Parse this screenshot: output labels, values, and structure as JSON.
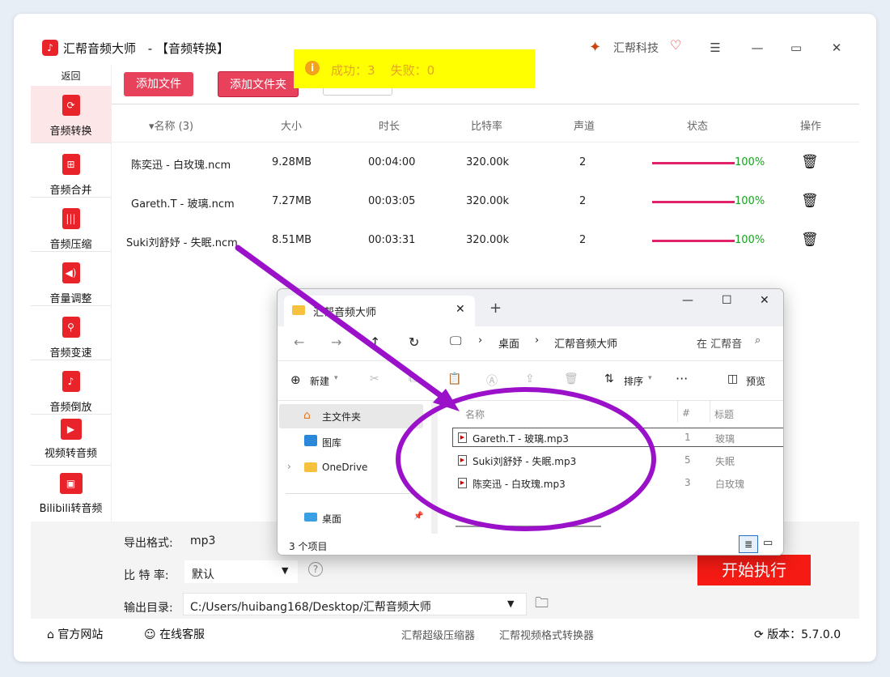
{
  "app": {
    "title": "汇帮音频大师",
    "page_title": "- 【音频转换】",
    "brand": "汇帮科技"
  },
  "sidebar": {
    "back_label": "返回",
    "items": [
      {
        "label": "音频转换",
        "icon": "audio-convert-icon",
        "active": true
      },
      {
        "label": "音频合并",
        "icon": "audio-merge-icon"
      },
      {
        "label": "音频压缩",
        "icon": "audio-compress-icon"
      },
      {
        "label": "音量调整",
        "icon": "volume-icon"
      },
      {
        "label": "音频变速",
        "icon": "mic-icon"
      },
      {
        "label": "音频倒放",
        "icon": "music-note-icon"
      },
      {
        "label": "视频转音频",
        "icon": "video-to-audio-icon"
      },
      {
        "label": "Bilibili转音频",
        "icon": "bilibili-icon"
      }
    ]
  },
  "toolbar": {
    "add_file": "添加文件",
    "add_folder": "添加文件夹"
  },
  "toast": {
    "text": "成功：3    失败：0"
  },
  "table": {
    "columns": [
      "▾名称 (3)",
      "大小",
      "时长",
      "比特率",
      "声道",
      "状态",
      "操作"
    ],
    "rows": [
      {
        "name": "陈奕迅 - 白玫瑰.ncm",
        "size": "9.28MB",
        "duration": "00:04:00",
        "bitrate": "320.00k",
        "channels": "2",
        "progress": "100%"
      },
      {
        "name": "Gareth.T - 玻璃.ncm",
        "size": "7.27MB",
        "duration": "00:03:05",
        "bitrate": "320.00k",
        "channels": "2",
        "progress": "100%"
      },
      {
        "name": "Suki刘舒妤 - 失眠.ncm",
        "size": "8.51MB",
        "duration": "00:03:31",
        "bitrate": "320.00k",
        "channels": "2",
        "progress": "100%"
      }
    ]
  },
  "settings": {
    "format_label": "导出格式:",
    "format_value": "mp3",
    "bitrate_label": "比 特 率:",
    "bitrate_value": "默认",
    "outdir_label": "输出目录:",
    "outdir_value": "C:/Users/huibang168/Desktop/汇帮音频大师",
    "start_button": "开始执行"
  },
  "footer": {
    "website": "官方网站",
    "support": "在线客服",
    "link1": "汇帮超级压缩器",
    "link2": "汇帮视频格式转换器",
    "version": "版本：5.7.0.0"
  },
  "explorer": {
    "tab_title": "汇帮音频大师",
    "breadcrumb": [
      "桌面",
      "汇帮音频大师"
    ],
    "search_placeholder": "在 汇帮音",
    "cmd_new": "新建",
    "cmd_sort": "排序",
    "cmd_preview": "预览",
    "nav_items": [
      "主文件夹",
      "图库",
      "OneDrive",
      "桌面"
    ],
    "col_name": "名称",
    "col_num": "#",
    "col_title": "标题",
    "files": [
      {
        "name": "Gareth.T - 玻璃.mp3",
        "num": "1",
        "title": "玻璃"
      },
      {
        "name": "Suki刘舒妤 - 失眠.mp3",
        "num": "5",
        "title": "失眠"
      },
      {
        "name": "陈奕迅 - 白玫瑰.mp3",
        "num": "3",
        "title": "白玫瑰"
      }
    ],
    "status": "3 个项目"
  }
}
